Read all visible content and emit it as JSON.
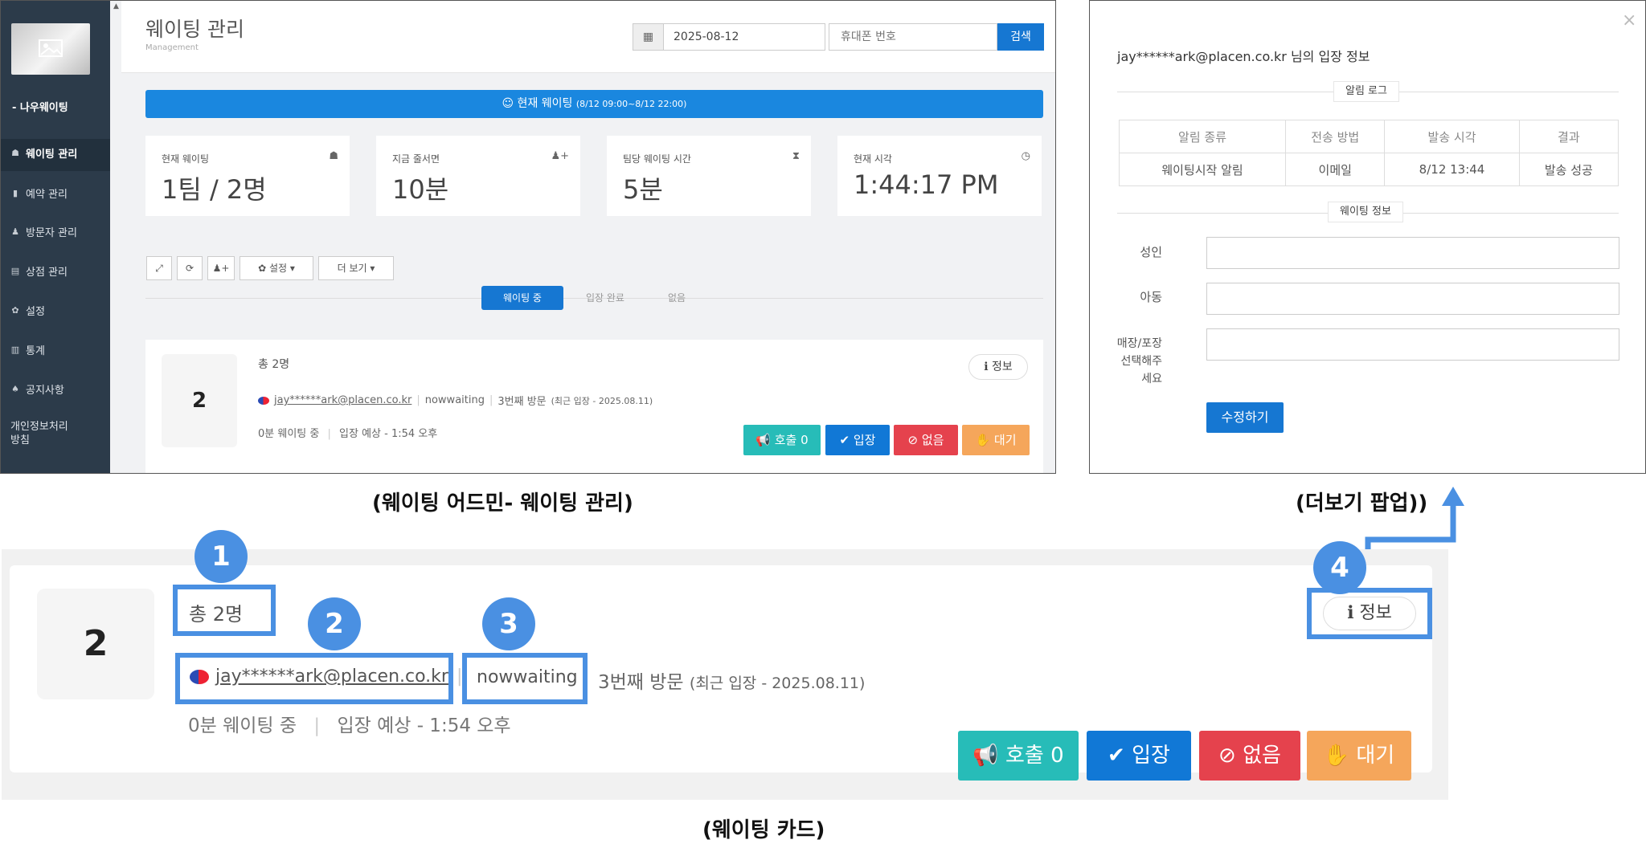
{
  "admin": {
    "sidebar": {
      "brand": "- 나우웨이팅",
      "items": [
        {
          "label": "웨이팅 관리",
          "icon": "users-icon",
          "glyph": "☗"
        },
        {
          "label": "예약 관리",
          "icon": "bookmark-icon",
          "glyph": "▮"
        },
        {
          "label": "방문자 관리",
          "icon": "person-icon",
          "glyph": "♟"
        },
        {
          "label": "상점 관리",
          "icon": "book-icon",
          "glyph": "▤"
        },
        {
          "label": "설정",
          "icon": "gear-icon",
          "glyph": "✿"
        },
        {
          "label": "통계",
          "icon": "bar-chart-icon",
          "glyph": "▥"
        },
        {
          "label": "공지사항",
          "icon": "bell-icon",
          "glyph": "♠"
        },
        {
          "label": "개인정보처리\n방침",
          "icon": "",
          "glyph": ""
        }
      ]
    },
    "header": {
      "title": "웨이팅 관리",
      "subtitle": "Management",
      "date_value": "2025-08-12",
      "phone_placeholder": "휴대폰 번호",
      "search_label": "검색"
    },
    "banner": {
      "text": "☺ 현재 웨이팅",
      "range": "(8/12 09:00~8/12 22:00)"
    },
    "stats": [
      {
        "label": "현재 웨이팅",
        "value": "1팀 / 2명",
        "icon": "group-icon",
        "glyph": "☗"
      },
      {
        "label": "지금 줄서면",
        "value": "10분",
        "icon": "add-user-icon",
        "glyph": "♟+"
      },
      {
        "label": "팀당 웨이팅 시간",
        "value": "5분",
        "icon": "hourglass-icon",
        "glyph": "⧗"
      },
      {
        "label": "현재 시각",
        "value": "1:44:17 PM",
        "icon": "clock-icon",
        "glyph": "◷"
      }
    ],
    "toolbar": {
      "expand_glyph": "⤢",
      "refresh_glyph": "⟳",
      "add_user_glyph": "♟+",
      "settings_label": "✿ 설정 ▾",
      "more_label": "더 보기 ▾"
    },
    "tabs": [
      "웨이팅 중",
      "입장 완료",
      "없음"
    ],
    "card": {
      "number": "2",
      "total": "총 2명",
      "email": "jay******ark@placen.co.kr",
      "source": "nowwaiting",
      "visit": "3번째 방문",
      "recent": "(최근 입장 - 2025.08.11)",
      "waiting": "0분 웨이팅 중",
      "expected": "입장 예상 - 1:54 오후",
      "info_label": "ℹ 정보",
      "buttons": {
        "call": "📢 호출 0",
        "enter": "✔ 입장",
        "none": "⊘ 없음",
        "wait": "✋ 대기"
      }
    }
  },
  "popup": {
    "close": "×",
    "title": "jay******ark@placen.co.kr 님의 입장 정보",
    "log_section": "알림 로그",
    "log_headers": [
      "알림 종류",
      "전송 방법",
      "발송 시각",
      "결과"
    ],
    "log_rows": [
      [
        "웨이팅시작 알림",
        "이메일",
        "8/12 13:44",
        "발송 성공"
      ]
    ],
    "info_section": "웨이팅 정보",
    "fields": [
      "성인",
      "아동",
      "매장/포장\n선택해주\n세요"
    ],
    "save_label": "수정하기"
  },
  "captions": {
    "admin": "(웨이팅 어드민- 웨이팅 관리)",
    "popup": "(더보기 팝업))",
    "card": "(웨이팅 카드)"
  },
  "callouts": [
    "1",
    "2",
    "3",
    "4"
  ],
  "colors": {
    "sidebar": "#2c3b4a",
    "primary": "#1677d2",
    "banner": "#1a87df",
    "call": "#27bcb8",
    "enter": "#1178d6",
    "none": "#e5424d",
    "wait": "#f5a65b",
    "highlight": "#4a90e2"
  }
}
